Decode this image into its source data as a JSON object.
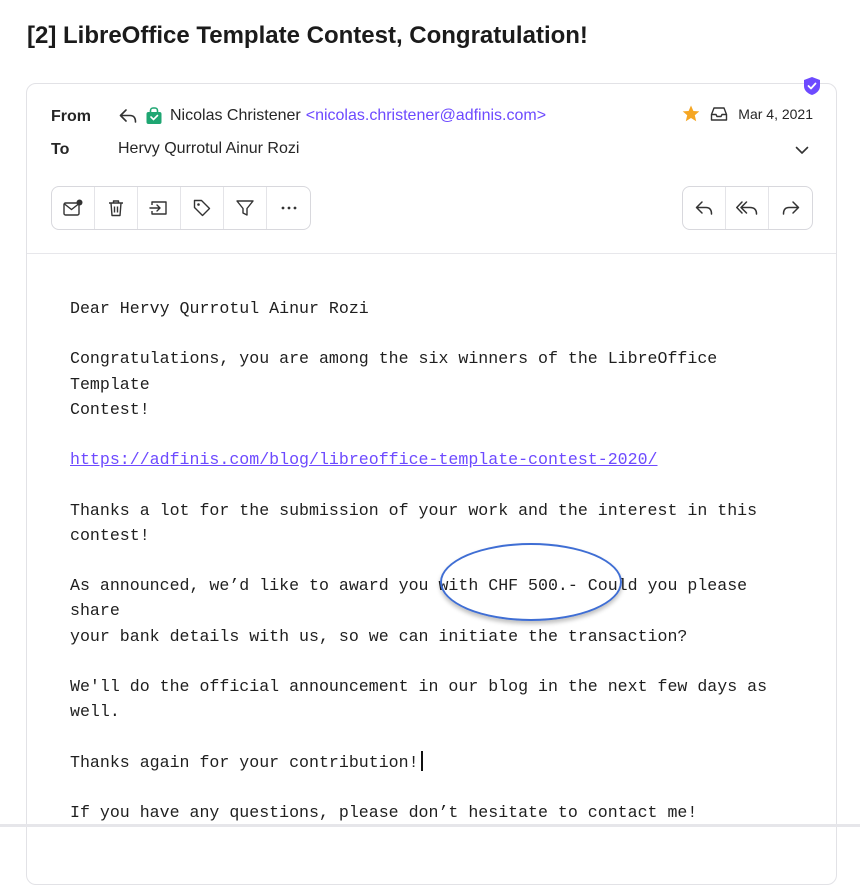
{
  "message": {
    "subject": "[2] LibreOffice Template Contest, Congratulation!",
    "from_label": "From",
    "to_label": "To",
    "sender_name": "Nicolas Christener",
    "sender_address": "<nicolas.christener@adfinis.com>",
    "recipient": "Hervy Qurrotul Ainur Rozi",
    "date": "Mar 4, 2021",
    "starred": true
  },
  "icons": {
    "verified": "shield-check-icon",
    "replied": "reply-arrow-icon",
    "sender_badge": "green-bag-icon",
    "star": "star-icon",
    "folder": "inbox-icon",
    "expand": "chevron-down-icon"
  },
  "toolbar": {
    "left": [
      "mark-unread-icon",
      "trash-icon",
      "move-icon",
      "label-icon",
      "filter-icon",
      "more-icon"
    ],
    "right": [
      "reply-icon",
      "reply-all-icon",
      "forward-icon"
    ]
  },
  "colors": {
    "accent": "#6d4aff",
    "star": "#f5a623",
    "badge": "#1ea672",
    "annotation": "#3f6ed4"
  },
  "body": {
    "greeting": "Dear Hervy Qurrotul Ainur Rozi",
    "p1": "Congratulations, you are among the six winners of the LibreOffice\nTemplate\nContest!",
    "link": "https://adfinis.com/blog/libreoffice-template-contest-2020/",
    "p2": "Thanks a lot for the submission of your work and the interest in this\ncontest!",
    "p3": "As announced, we’d like to award you with CHF 500.- Could you please\nshare\nyour bank details with us, so we can initiate the transaction?",
    "p4": "We'll do the official announcement in our blog in the next few days as\nwell.",
    "p5": "Thanks again for your contribution!",
    "p6": "If you have any questions, please don’t hesitate to contact me!"
  }
}
